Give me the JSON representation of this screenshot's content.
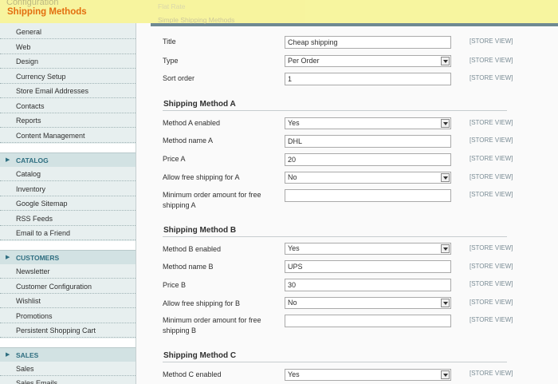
{
  "header": {
    "breadcrumb": "Configuration",
    "page_title": "Shipping Methods",
    "faded_section_1": "Flat Rate",
    "faded_section_2": "Simple Shipping Methods"
  },
  "sidebar": {
    "general_items": [
      "General",
      "Web",
      "Design",
      "Currency Setup",
      "Store Email Addresses",
      "Contacts",
      "Reports",
      "Content Management"
    ],
    "sections": [
      {
        "title": "CATALOG",
        "items": [
          "Catalog",
          "Inventory",
          "Google Sitemap",
          "RSS Feeds",
          "Email to a Friend"
        ]
      },
      {
        "title": "CUSTOMERS",
        "items": [
          "Newsletter",
          "Customer Configuration",
          "Wishlist",
          "Promotions",
          "Persistent Shopping Cart"
        ]
      },
      {
        "title": "SALES",
        "items": [
          "Sales",
          "Sales Emails"
        ]
      }
    ]
  },
  "form": {
    "scope_label": "[STORE VIEW]",
    "general": {
      "title_label": "Title",
      "title_value": "Cheap shipping",
      "type_label": "Type",
      "type_value": "Per Order",
      "sort_label": "Sort order",
      "sort_value": "1"
    },
    "method_a": {
      "heading": "Shipping Method A",
      "enabled_label": "Method A enabled",
      "enabled_value": "Yes",
      "name_label": "Method name A",
      "name_value": "DHL",
      "price_label": "Price A",
      "price_value": "20",
      "free_label": "Allow free shipping for A",
      "free_value": "No",
      "min_label_1": "Minimum order amount for free",
      "min_label_2": "shipping A",
      "min_value": ""
    },
    "method_b": {
      "heading": "Shipping Method B",
      "enabled_label": "Method B enabled",
      "enabled_value": "Yes",
      "name_label": "Method name B",
      "name_value": "UPS",
      "price_label": "Price B",
      "price_value": "30",
      "free_label": "Allow free shipping for B",
      "free_value": "No",
      "min_label_1": "Minimum order amount for free",
      "min_label_2": "shipping B",
      "min_value": ""
    },
    "method_c": {
      "heading": "Shipping Method C",
      "enabled_label": "Method C enabled",
      "enabled_value": "Yes"
    }
  }
}
